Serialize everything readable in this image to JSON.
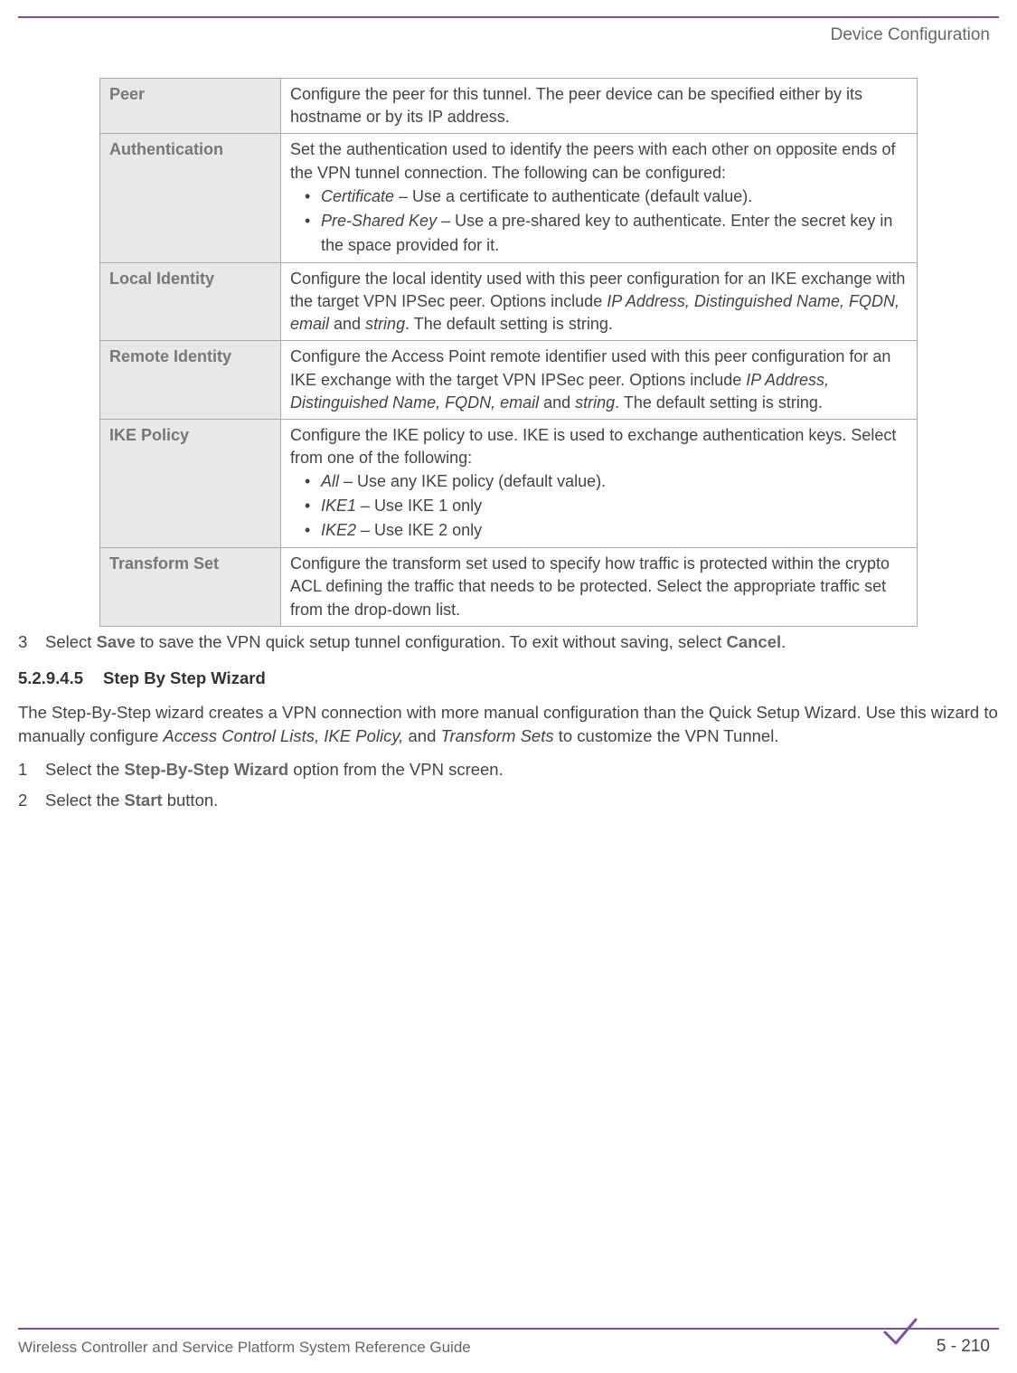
{
  "header": {
    "title": "Device Configuration"
  },
  "table": {
    "rows": [
      {
        "label": "Peer",
        "desc": "Configure the peer for this tunnel. The peer device can be specified either by its hostname or by its IP address."
      },
      {
        "label": "Authentication",
        "desc": "Set the authentication used to identify the peers with each other on opposite ends of the VPN tunnel connection. The following can be configured:",
        "bullets": [
          {
            "term": "Certificate",
            "rest": " – Use a certificate to authenticate (default value)."
          },
          {
            "term": "Pre-Shared Key",
            "rest": " – Use a pre-shared key to authenticate. Enter the secret key in the space provided for it."
          }
        ]
      },
      {
        "label": "Local Identity",
        "desc_pre": "Configure the local identity used with this peer configuration for an IKE exchange with the target VPN IPSec peer. Options include ",
        "desc_italics": "IP Address, Distinguished Name, FQDN, email",
        "desc_mid": " and ",
        "desc_italics2": "string",
        "desc_post": ". The default setting is string."
      },
      {
        "label": "Remote Identity",
        "desc_pre": "Configure the Access Point remote identifier used with this peer configuration for an IKE exchange with the target VPN IPSec peer. Options include ",
        "desc_italics": "IP Address, Distinguished Name, FQDN, email",
        "desc_mid": " and ",
        "desc_italics2": "string",
        "desc_post": ". The default setting is string."
      },
      {
        "label": "IKE Policy",
        "desc": "Configure the IKE policy to use. IKE is used to exchange authentication keys. Select from one of the following:",
        "bullets": [
          {
            "term": "All",
            "rest": " – Use any IKE policy (default value)."
          },
          {
            "term": "IKE1",
            "rest": " – Use IKE 1 only"
          },
          {
            "term": "IKE2",
            "rest": " – Use IKE 2 only"
          }
        ]
      },
      {
        "label": "Transform Set",
        "desc": "Configure the transform set used to specify how traffic is protected within the crypto ACL defining the traffic that needs to be protected. Select the appropriate traffic set from the drop-down list."
      }
    ]
  },
  "steps": {
    "step3_pre": "Select ",
    "step3_bold1": "Save",
    "step3_mid": " to save the VPN quick setup tunnel configuration. To exit without saving, select ",
    "step3_bold2": "Cancel",
    "step3_post": "."
  },
  "section": {
    "number": "5.2.9.4.5",
    "title": "Step By Step Wizard"
  },
  "intro_pre": "The Step-By-Step wizard creates a VPN connection with more manual configuration than the Quick Setup Wizard. Use this wizard to manually configure ",
  "intro_italic": "Access Control Lists, IKE Policy,",
  "intro_mid": " and ",
  "intro_italic2": "Transform Sets",
  "intro_post": " to customize the VPN Tunnel.",
  "steps2": {
    "s1_pre": "Select the ",
    "s1_bold": "Step-By-Step Wizard",
    "s1_post": " option from the VPN screen.",
    "s2_pre": "Select the ",
    "s2_bold": "Start",
    "s2_post": " button."
  },
  "footer": {
    "left": "Wireless Controller and Service Platform System Reference Guide",
    "right": "5 - 210"
  }
}
